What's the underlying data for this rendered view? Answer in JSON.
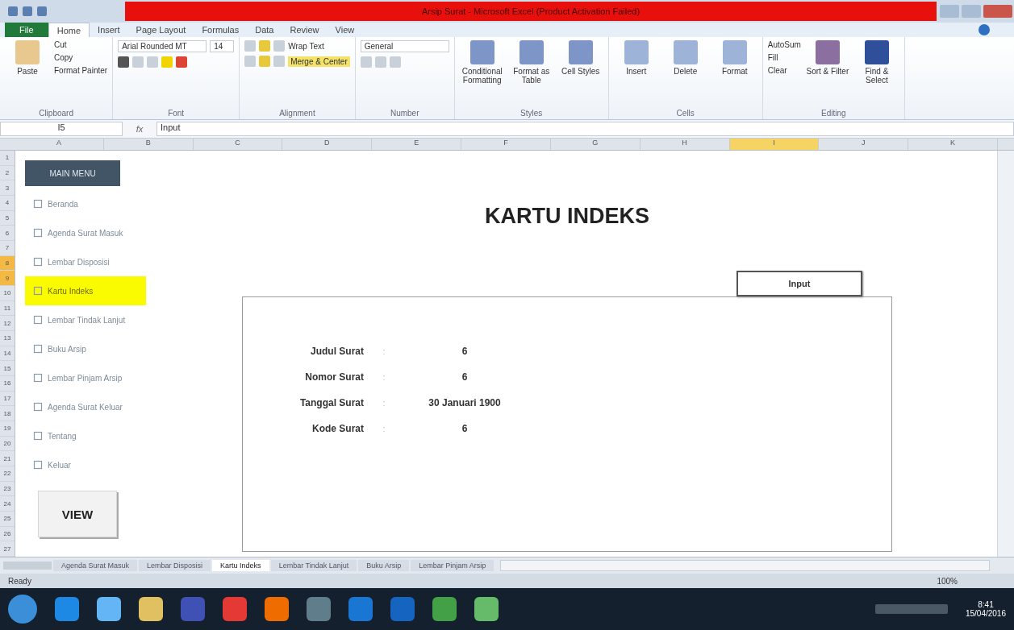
{
  "window": {
    "title": "Arsip Surat - Microsoft Excel (Product Activation Failed)"
  },
  "file_tab": "File",
  "ribbon_tabs": [
    {
      "label": "Home",
      "selected": true
    },
    {
      "label": "Insert",
      "selected": false
    },
    {
      "label": "Page Layout",
      "selected": false
    },
    {
      "label": "Formulas",
      "selected": false
    },
    {
      "label": "Data",
      "selected": false
    },
    {
      "label": "Review",
      "selected": false
    },
    {
      "label": "View",
      "selected": false
    }
  ],
  "ribbon": {
    "clipboard": {
      "paste": "Paste",
      "cut": "Cut",
      "copy": "Copy",
      "format_painter": "Format Painter",
      "label": "Clipboard"
    },
    "font": {
      "name": "Arial Rounded MT",
      "size": "14",
      "label": "Font"
    },
    "alignment": {
      "wrap": "Wrap Text",
      "merge": "Merge & Center",
      "label": "Alignment"
    },
    "number": {
      "format": "General",
      "label": "Number"
    },
    "styles": {
      "buttons": [
        "Conditional Formatting",
        "Format as Table",
        "Cell Styles"
      ],
      "label": "Styles"
    },
    "cells": {
      "buttons": [
        "Insert",
        "Delete",
        "Format"
      ],
      "label": "Cells"
    },
    "editing": {
      "autosum": "AutoSum",
      "fill": "Fill",
      "clear": "Clear",
      "sort": "Sort & Filter",
      "find": "Find & Select",
      "label": "Editing"
    }
  },
  "formula_bar": {
    "name_box": "I5",
    "fx": "fx",
    "value": "Input"
  },
  "columns": [
    {
      "label": "A",
      "selected": false
    },
    {
      "label": "B",
      "selected": false
    },
    {
      "label": "C",
      "selected": false
    },
    {
      "label": "D",
      "selected": false
    },
    {
      "label": "E",
      "selected": false
    },
    {
      "label": "F",
      "selected": false
    },
    {
      "label": "G",
      "selected": false
    },
    {
      "label": "H",
      "selected": false
    },
    {
      "label": "I",
      "selected": true
    },
    {
      "label": "J",
      "selected": false
    },
    {
      "label": "K",
      "selected": false
    }
  ],
  "rows": [
    {
      "label": "1",
      "selected": false
    },
    {
      "label": "2",
      "selected": false
    },
    {
      "label": "3",
      "selected": false
    },
    {
      "label": "4",
      "selected": false
    },
    {
      "label": "5",
      "selected": false
    },
    {
      "label": "6",
      "selected": false
    },
    {
      "label": "7",
      "selected": false
    },
    {
      "label": "8",
      "selected": true
    },
    {
      "label": "9",
      "selected": true
    },
    {
      "label": "10",
      "selected": false
    },
    {
      "label": "11",
      "selected": false
    },
    {
      "label": "12",
      "selected": false
    },
    {
      "label": "13",
      "selected": false
    },
    {
      "label": "14",
      "selected": false
    },
    {
      "label": "15",
      "selected": false
    },
    {
      "label": "16",
      "selected": false
    },
    {
      "label": "17",
      "selected": false
    },
    {
      "label": "18",
      "selected": false
    },
    {
      "label": "19",
      "selected": false
    },
    {
      "label": "20",
      "selected": false
    },
    {
      "label": "21",
      "selected": false
    },
    {
      "label": "22",
      "selected": false
    },
    {
      "label": "23",
      "selected": false
    },
    {
      "label": "24",
      "selected": false
    },
    {
      "label": "25",
      "selected": false
    },
    {
      "label": "26",
      "selected": false
    },
    {
      "label": "27",
      "selected": false
    }
  ],
  "sidebar": {
    "header": "MAIN MENU",
    "items": [
      {
        "label": "Beranda",
        "selected": false
      },
      {
        "label": "Agenda Surat Masuk",
        "selected": false
      },
      {
        "label": "Lembar Disposisi",
        "selected": false
      },
      {
        "label": "Kartu Indeks",
        "selected": true
      },
      {
        "label": "Lembar Tindak Lanjut",
        "selected": false
      },
      {
        "label": "Buku Arsip",
        "selected": false
      },
      {
        "label": "Lembar Pinjam Arsip",
        "selected": false
      },
      {
        "label": "Agenda Surat Keluar",
        "selected": false
      },
      {
        "label": "Tentang",
        "selected": false
      },
      {
        "label": "Keluar",
        "selected": false
      }
    ],
    "view_button": "VIEW"
  },
  "page": {
    "title": "KARTU INDEKS",
    "input_button": "Input",
    "fields": [
      {
        "label": "Judul Surat",
        "sep": ":",
        "value": "6"
      },
      {
        "label": "Nomor Surat",
        "sep": ":",
        "value": "6"
      },
      {
        "label": "Tanggal Surat",
        "sep": ":",
        "value": "30 Januari 1900"
      },
      {
        "label": "Kode Surat",
        "sep": ":",
        "value": "6"
      }
    ]
  },
  "sheet_tabs": [
    {
      "label": "Agenda Surat Masuk",
      "selected": false
    },
    {
      "label": "Lembar Disposisi",
      "selected": false
    },
    {
      "label": "Kartu Indeks",
      "selected": true
    },
    {
      "label": "Lembar Tindak Lanjut",
      "selected": false
    },
    {
      "label": "Buku Arsip",
      "selected": false
    },
    {
      "label": "Lembar Pinjam Arsip",
      "selected": false
    }
  ],
  "status_bar": {
    "mode": "Ready",
    "zoom": "100%"
  },
  "taskbar": {
    "time": "8:41",
    "date": "15/04/2016"
  }
}
